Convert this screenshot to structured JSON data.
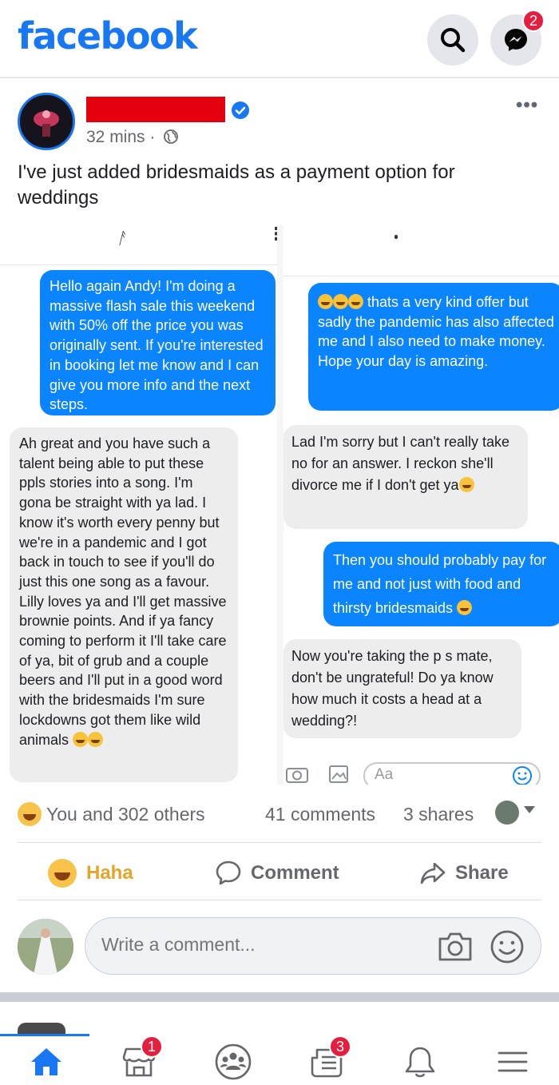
{
  "header": {
    "logo": "facebook",
    "messenger_badge": "2"
  },
  "post": {
    "time": "32 mins ·",
    "text": "I've just added bridesmaids as a payment option for weddings",
    "left_messages": [
      {
        "type": "out",
        "text": "Hello again Andy! I'm doing a massive flash sale this weekend with 50% off the price you was originally sent. If you're interested in booking let me know and I can give you more info and the next steps."
      },
      {
        "type": "in",
        "text": "Ah great and you have such a talent being able to put these ppls stories into a song. I'm gona be straight with ya lad. I know it's worth every penny but we're in a pandemic and I got back in touch to see if you'll do just this one song as a favour. Lilly loves ya and I'll get massive brownie points. And if ya fancy coming to perform it I'll take care of ya, bit of grub and a couple beers and I'll put in a good word with the bridesmaids I'm sure lockdowns got them like wild animals"
      }
    ],
    "right_messages": [
      {
        "type": "out",
        "text": "thats a very kind offer but sadly the pandemic has also affected me and I also need to make money. Hope your day is amazing."
      },
      {
        "type": "in",
        "text": "Lad I'm sorry but I can't really take no for an answer. I reckon she'll divorce me if I don't get ya"
      },
      {
        "type": "out",
        "text": "Then you should probably pay for me and not just with food and thirsty bridesmaids"
      },
      {
        "type": "in",
        "text": "Now you're taking the p   s mate, don't be ungrateful! Do ya know how much it costs a head at a wedding?!"
      }
    ],
    "inner_input_placeholder": "Aa",
    "reactions_text": "You and 302 others",
    "comments_count": "41 comments",
    "shares_count": "3 shares"
  },
  "actions": {
    "haha": "Haha",
    "comment": "Comment",
    "share": "Share"
  },
  "composer": {
    "placeholder": "Write a comment..."
  },
  "nav": {
    "marketplace_badge": "1",
    "news_badge": "3"
  },
  "colors": {
    "brand": "#1877f2",
    "messenger_bubble": "#0a84ff",
    "badge": "#e41e3f",
    "redaction": "#e4000f"
  }
}
